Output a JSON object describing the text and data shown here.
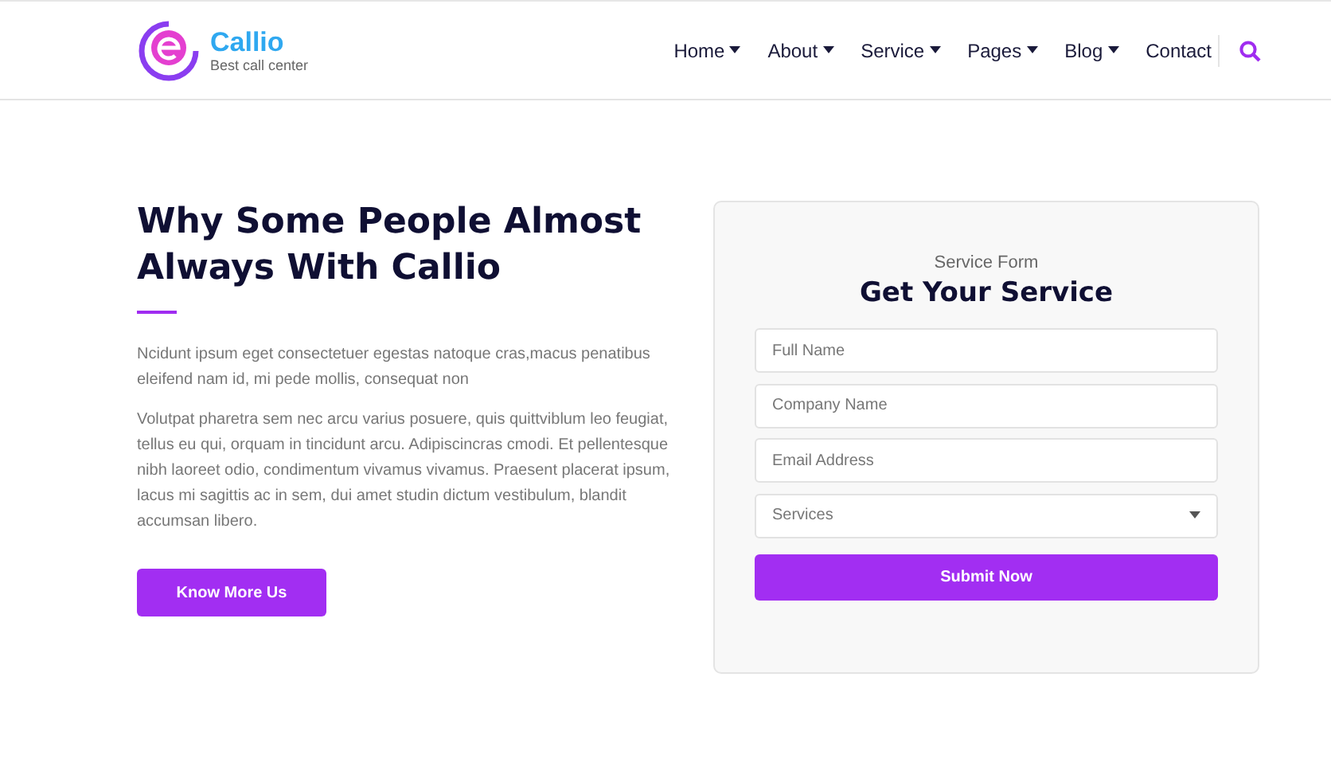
{
  "brand": {
    "name": "Callio",
    "tagline": "Best call center"
  },
  "nav": [
    {
      "label": "Home",
      "kind": "dropdown"
    },
    {
      "label": "About",
      "kind": "dropdown"
    },
    {
      "label": "Service",
      "kind": "dropdown"
    },
    {
      "label": "Pages",
      "kind": "dropdown"
    },
    {
      "label": "Blog",
      "kind": "dropdown"
    },
    {
      "label": "Contact",
      "kind": "link"
    }
  ],
  "intro": {
    "title": "Why Some People Almost Always With Callio",
    "paragraphs": [
      "Ncidunt ipsum eget consectetuer egestas natoque cras,macus penatibus eleifend nam id, mi pede mollis, consequat non",
      "Volutpat pharetra sem nec arcu varius posuere, quis quittviblum leo feugiat, tellus eu qui, orquam in tincidunt arcu. Adipiscincras cmodi. Et pellentesque nibh laoreet odio, condimentum vivamus vivamus. Praesent placerat ipsum, lacus mi sagittis ac in sem, dui amet studin dictum vestibulum, blandit accumsan libero."
    ],
    "button": "Know More Us"
  },
  "form": {
    "subtitle": "Service Form",
    "title": "Get Your Service",
    "fields": [
      {
        "placeholder": "Full Name",
        "kind": "text"
      },
      {
        "placeholder": "Company Name",
        "kind": "text"
      },
      {
        "placeholder": "Email Address",
        "kind": "text"
      },
      {
        "placeholder": "Services",
        "kind": "select"
      }
    ],
    "submit": "Submit Now"
  }
}
